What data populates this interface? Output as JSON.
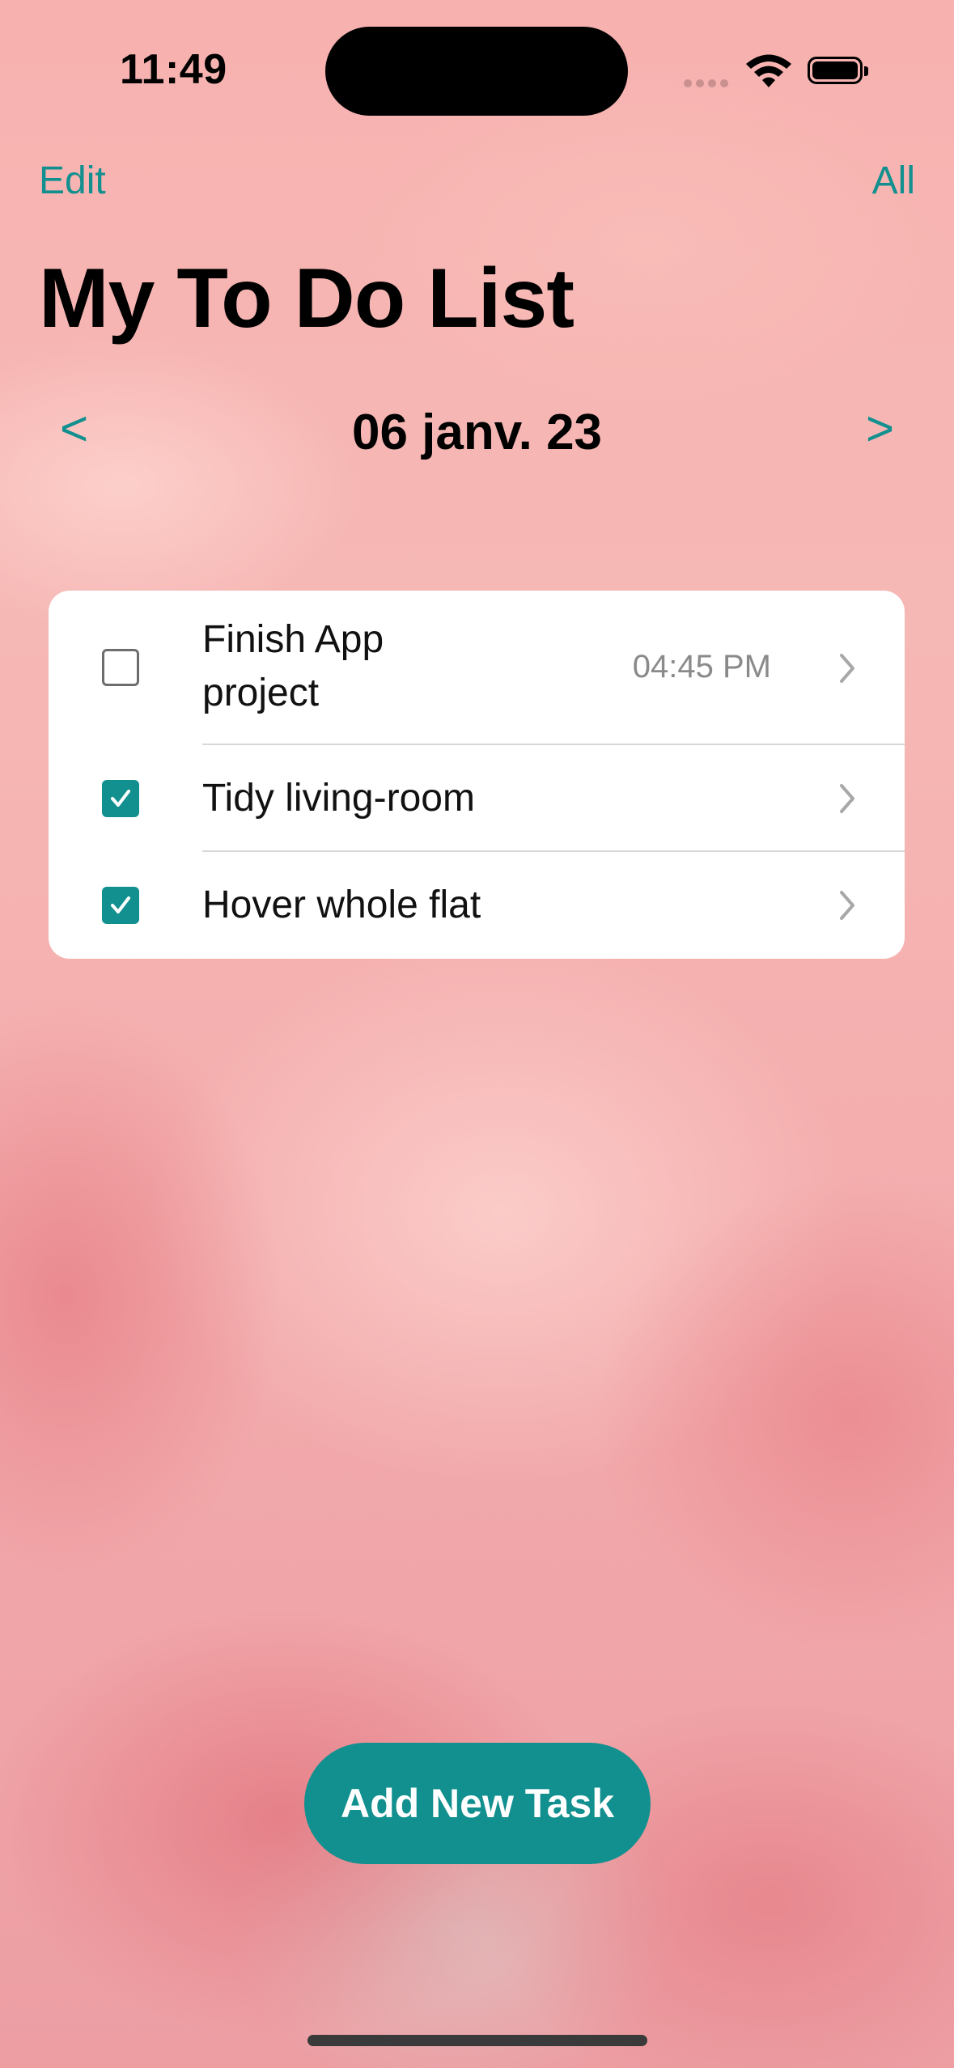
{
  "status_bar": {
    "time": "11:49"
  },
  "nav": {
    "edit_label": "Edit",
    "all_label": "All"
  },
  "page": {
    "title": "My To Do List"
  },
  "date_nav": {
    "prev_label": "<",
    "date": "06 janv. 23",
    "next_label": ">"
  },
  "tasks": [
    {
      "title": "Finish App project",
      "time": "04:45 PM",
      "completed": false
    },
    {
      "title": "Tidy living-room",
      "time": "",
      "completed": true
    },
    {
      "title": "Hover whole flat",
      "time": "",
      "completed": true
    }
  ],
  "actions": {
    "add_task_label": "Add New Task"
  },
  "colors": {
    "accent": "#12908f",
    "card": "#ffffff",
    "background": "#f4b4b4"
  },
  "icons": [
    "wifi-icon",
    "battery-icon",
    "checkbox-icon",
    "checkmark-icon",
    "chevron-right-icon"
  ]
}
